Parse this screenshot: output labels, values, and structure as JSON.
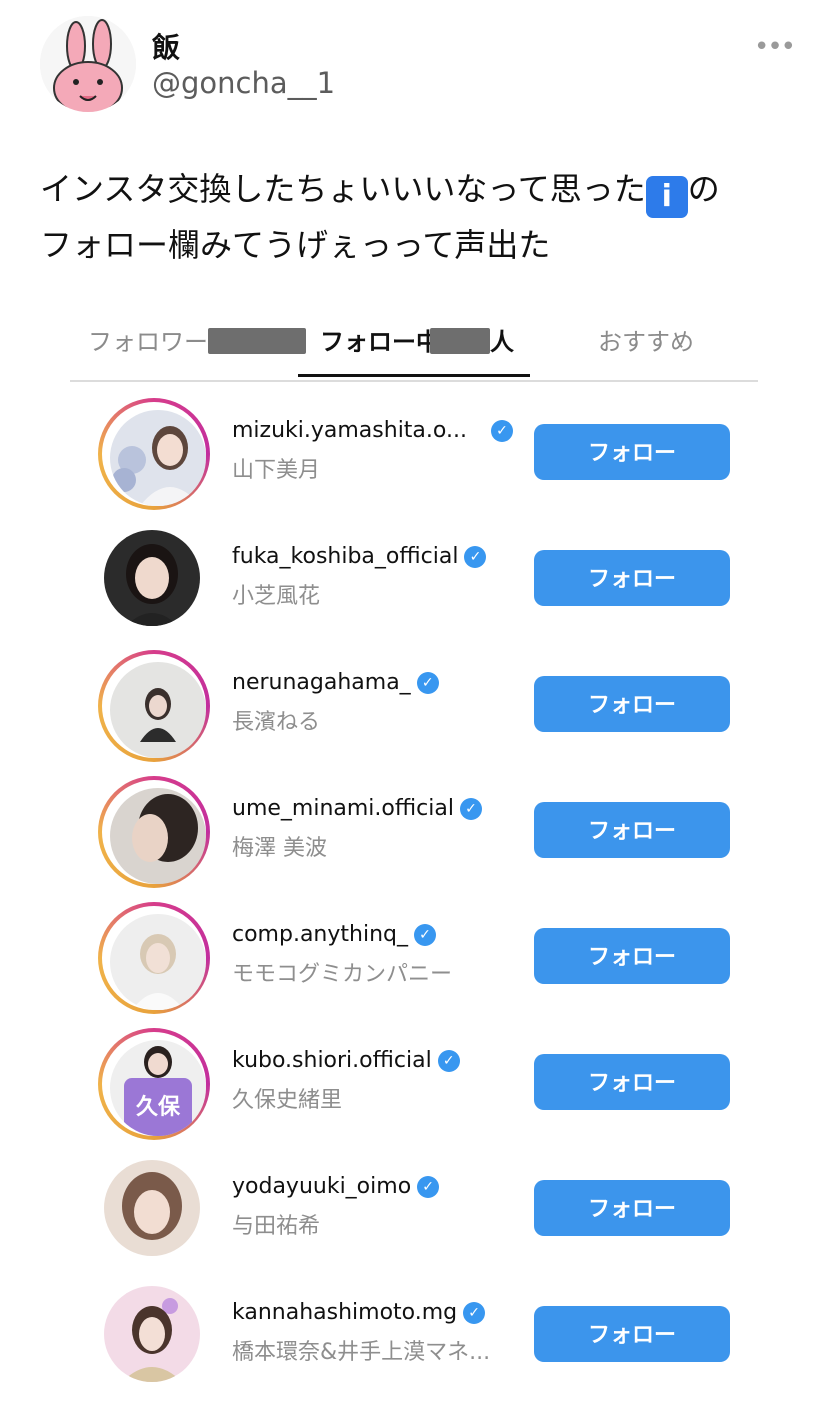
{
  "tweet": {
    "display_name": "飯",
    "handle": "@goncha__1",
    "more_label": "•••",
    "text_part1": "インスタ交換したちょいいいなって思った",
    "emoji": "i",
    "text_part2": "の",
    "text_line2": "フォロー欄みてうげぇっって声出た"
  },
  "tabs": {
    "followers": "フォロワー",
    "following_prefix": "フォロー中",
    "following_suffix": "人",
    "recommended": "おすすめ"
  },
  "accounts": [
    {
      "username": "mizuki.yamashita.o...",
      "name": "山下美月",
      "button": "フォロー"
    },
    {
      "username": "fuka_koshiba_official",
      "name": "小芝風花",
      "button": "フォロー"
    },
    {
      "username": "nerunagahama_",
      "name": "長濱ねる",
      "button": "フォロー"
    },
    {
      "username": "ume_minami.official",
      "name": "梅澤 美波",
      "button": "フォロー"
    },
    {
      "username": "comp.anythinq_",
      "name": "モモコグミカンパニー",
      "button": "フォロー"
    },
    {
      "username": "kubo.shiori.official",
      "name": "久保史緒里",
      "button": "フォロー",
      "shirt_text": "久保"
    },
    {
      "username": "yodayuuki_oimo",
      "name": "与田祐希",
      "button": "フォロー"
    },
    {
      "username": "kannahashimoto.mg",
      "name": "橋本環奈&井手上漠マネ...",
      "button": "フォロー"
    }
  ],
  "verified_icon": "verified-check-icon",
  "colors": {
    "follow_button": "#3c95ec",
    "verified_badge": "#3897f0",
    "story_ring": "#d63c8b"
  }
}
